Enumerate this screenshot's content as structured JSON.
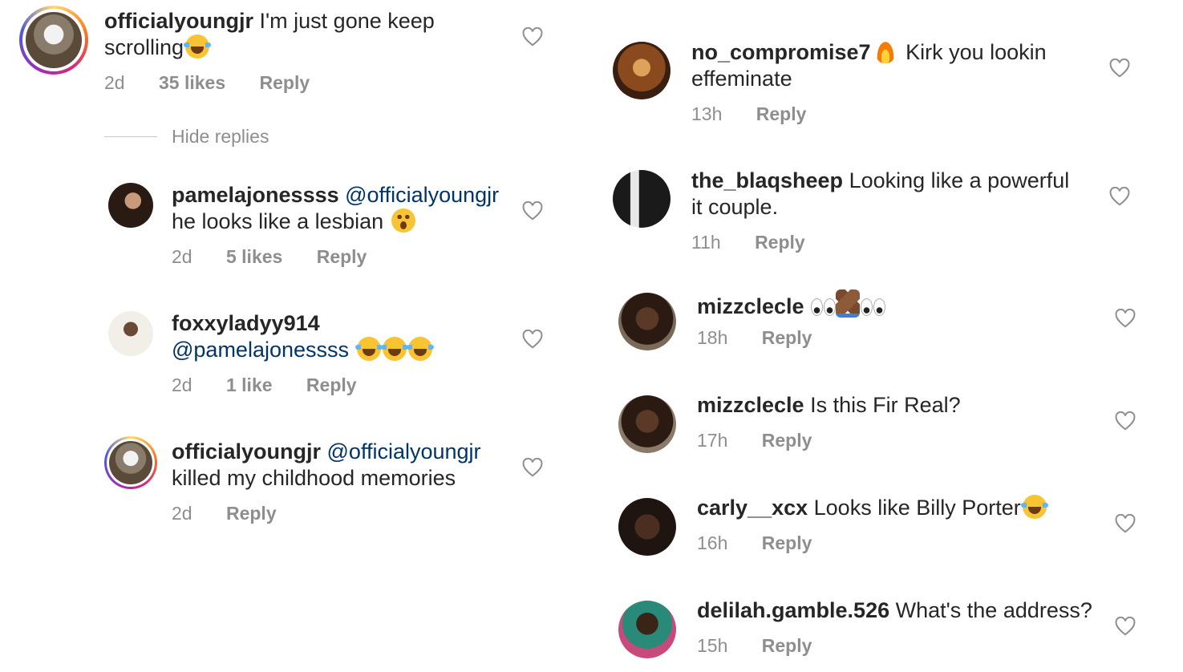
{
  "left": {
    "comments": [
      {
        "username": "officialyoungjr",
        "text": " I'm just gone keep",
        "text2": "scrolling",
        "time": "2d",
        "likes": "35 likes",
        "reply": "Reply"
      },
      {
        "username": "pamelajonessss",
        "mention": " @officialyoungjr",
        "text2": "he looks like a lesbian ",
        "time": "2d",
        "likes": "5 likes",
        "reply": "Reply"
      },
      {
        "username": "foxxyladyy914",
        "mention": "@pamelajonessss ",
        "time": "2d",
        "likes": "1 like",
        "reply": "Reply"
      },
      {
        "username": "officialyoungjr",
        "mention": " @officialyoungjr",
        "text2": "killed my childhood memories",
        "time": "2d",
        "reply": "Reply"
      }
    ],
    "hide_replies": "Hide replies"
  },
  "right": {
    "comments": [
      {
        "username": "no_compromise7",
        "text": " Kirk you lookin",
        "text2": "effeminate",
        "time": "13h",
        "reply": "Reply"
      },
      {
        "username": "the_blaqsheep",
        "text": " Looking like a powerful",
        "text2": "it couple.",
        "time": "11h",
        "reply": "Reply"
      },
      {
        "username": "mizzclecle",
        "time": "18h",
        "reply": "Reply"
      },
      {
        "username": "mizzclecle",
        "text": " Is this Fir Real?",
        "time": "17h",
        "reply": "Reply"
      },
      {
        "username": "carly__xcx",
        "text": " Looks like Billy Porter",
        "time": "16h",
        "reply": "Reply"
      },
      {
        "username": "delilah.gamble.526",
        "text": " What's the address?",
        "time": "15h",
        "reply": "Reply"
      }
    ]
  },
  "colors": {
    "mention": "#003569",
    "meta": "#8e8e8e",
    "text": "#262626"
  },
  "icons": [
    "heart-icon",
    "laughing-tears-emoji",
    "surprised-emoji",
    "fire-emoji",
    "eyes-emoji",
    "folded-hands-emoji"
  ]
}
